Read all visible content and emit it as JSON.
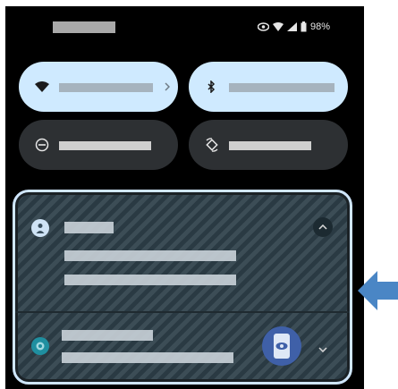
{
  "status_bar": {
    "battery_text": "98%",
    "icons": [
      "eye-icon",
      "wifi-icon",
      "signal-icon",
      "battery-icon"
    ]
  },
  "quick_settings": {
    "tiles": [
      {
        "id": "internet",
        "icon": "wifi-icon",
        "active": true,
        "has_chevron": true
      },
      {
        "id": "bluetooth",
        "icon": "bluetooth-icon",
        "active": true,
        "has_chevron": false
      },
      {
        "id": "do-not-disturb",
        "icon": "do-not-disturb-icon",
        "active": false,
        "has_chevron": false
      },
      {
        "id": "auto-rotate",
        "icon": "auto-rotate-icon",
        "active": false,
        "has_chevron": false
      }
    ]
  },
  "notifications": [
    {
      "icon": "account-icon",
      "expanded": true,
      "chevron": "chevron-up-icon"
    },
    {
      "icon": "app-icon",
      "expanded": false,
      "chevron": "chevron-down-icon",
      "large_icon": "phone-app-icon"
    }
  ],
  "colors": {
    "tile_on": "#cfeaff",
    "tile_off": "#2d3033",
    "highlight_border": "#cfe6fb",
    "arrow": "#4a86c5"
  }
}
